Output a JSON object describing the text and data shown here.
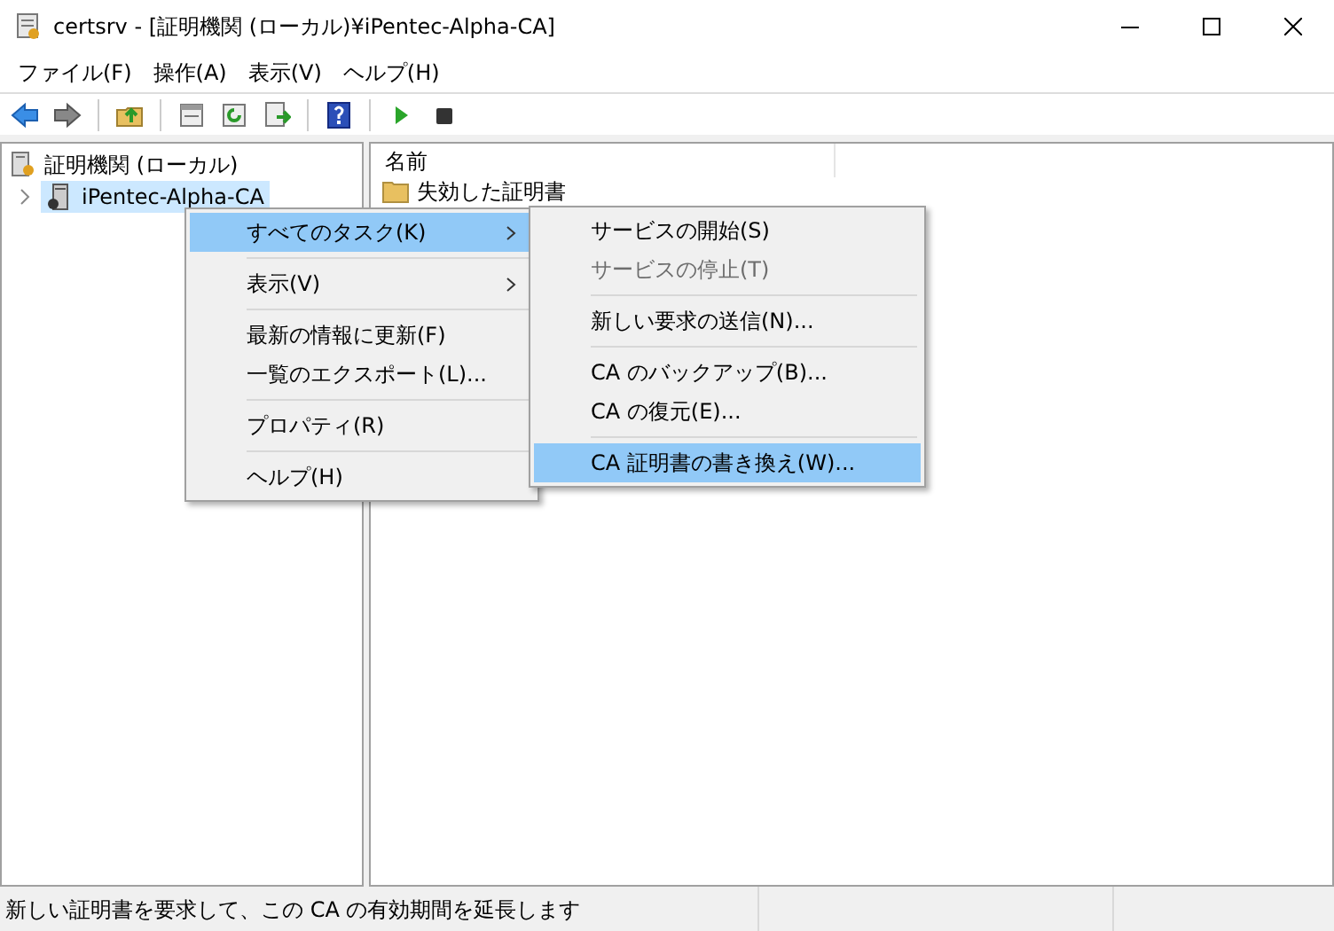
{
  "window": {
    "title": "certsrv - [証明機関 (ローカル)¥iPentec-Alpha-CA]"
  },
  "menu_bar": [
    "ファイル(F)",
    "操作(A)",
    "表示(V)",
    "ヘルプ(H)"
  ],
  "toolbar": [
    {
      "kind": "back"
    },
    {
      "kind": "forward"
    },
    {
      "kind": "sep"
    },
    {
      "kind": "up"
    },
    {
      "kind": "sep"
    },
    {
      "kind": "view"
    },
    {
      "kind": "refresh"
    },
    {
      "kind": "export"
    },
    {
      "kind": "sep"
    },
    {
      "kind": "help"
    },
    {
      "kind": "sep"
    },
    {
      "kind": "play"
    },
    {
      "kind": "stop"
    }
  ],
  "tree": {
    "label": "証明機関 (ローカル)",
    "children": [
      {
        "label": "iPentec-Alpha-CA",
        "selected": true,
        "expanded": false
      }
    ]
  },
  "list": {
    "columns": [
      "名前"
    ],
    "rows": [
      "失効した証明書"
    ]
  },
  "context_menu": [
    {
      "kind": "item",
      "label": "すべてのタスク(K)",
      "submenu": true,
      "selected": true
    },
    {
      "kind": "separator"
    },
    {
      "kind": "item",
      "label": "表示(V)",
      "submenu": true,
      "selected": false
    },
    {
      "kind": "separator"
    },
    {
      "kind": "item",
      "label": "最新の情報に更新(F)",
      "submenu": false,
      "selected": false
    },
    {
      "kind": "item",
      "label": "一覧のエクスポート(L)...",
      "submenu": false,
      "selected": false
    },
    {
      "kind": "separator"
    },
    {
      "kind": "item",
      "label": "プロパティ(R)",
      "submenu": false,
      "selected": false
    },
    {
      "kind": "separator"
    },
    {
      "kind": "item",
      "label": "ヘルプ(H)",
      "submenu": false,
      "selected": false
    }
  ],
  "submenu": [
    {
      "kind": "item",
      "label": "サービスの開始(S)",
      "disabled": false,
      "selected": false
    },
    {
      "kind": "item",
      "label": "サービスの停止(T)",
      "disabled": true,
      "selected": false
    },
    {
      "kind": "separator"
    },
    {
      "kind": "item",
      "label": "新しい要求の送信(N)...",
      "disabled": false,
      "selected": false
    },
    {
      "kind": "separator"
    },
    {
      "kind": "item",
      "label": "CA のバックアップ(B)...",
      "disabled": false,
      "selected": false
    },
    {
      "kind": "item",
      "label": "CA の復元(E)...",
      "disabled": false,
      "selected": false
    },
    {
      "kind": "separator"
    },
    {
      "kind": "item",
      "label": "CA 証明書の書き換え(W)...",
      "disabled": false,
      "selected": true
    }
  ],
  "status_bar": "新しい証明書を要求して、この CA の有効期間を延長します"
}
